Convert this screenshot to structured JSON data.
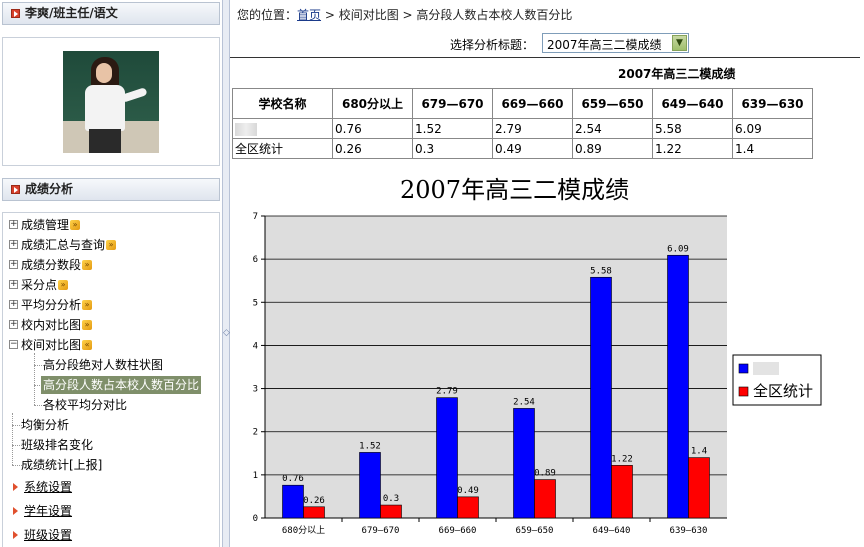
{
  "user_header": {
    "title": "李爽/班主任/语文"
  },
  "section_header": {
    "title": "成绩分析"
  },
  "tree": {
    "items": [
      {
        "label": "成绩管理",
        "expanded": false
      },
      {
        "label": "成绩汇总与查询",
        "expanded": false
      },
      {
        "label": "成绩分数段",
        "expanded": false
      },
      {
        "label": "采分点",
        "expanded": false
      },
      {
        "label": "平均分分析",
        "expanded": false
      },
      {
        "label": "校内对比图",
        "expanded": false
      },
      {
        "label": "校间对比图",
        "expanded": true
      }
    ],
    "sub_items": [
      {
        "label": "高分段绝对人数柱状图",
        "selected": false
      },
      {
        "label": "高分段人数占本校人数百分比",
        "selected": true
      },
      {
        "label": "各校平均分对比",
        "selected": false
      }
    ],
    "leaf_items": [
      {
        "label": "均衡分析"
      },
      {
        "label": "班级排名变化"
      },
      {
        "label": "成绩统计[上报]"
      }
    ]
  },
  "menu_links": [
    {
      "label": "系统设置"
    },
    {
      "label": "学年设置"
    },
    {
      "label": "班级设置"
    }
  ],
  "breadcrumb": {
    "prefix": "您的位置：",
    "home": "首页",
    "sep1": " > ",
    "level1": "校间对比图",
    "sep2": " > ",
    "level2": "高分段人数占本校人数百分比"
  },
  "selector": {
    "label": "选择分析标题：",
    "value": "2007年高三二模成绩"
  },
  "table": {
    "title": "2007年高三二模成绩",
    "headers": [
      "学校名称",
      "680分以上",
      "679—670",
      "669—660",
      "659—650",
      "649—640",
      "639—630"
    ],
    "rows": [
      {
        "name": "",
        "values": [
          "0.76",
          "1.52",
          "2.79",
          "2.54",
          "5.58",
          "6.09"
        ]
      },
      {
        "name": "全区统计",
        "values": [
          "0.26",
          "0.3",
          "0.49",
          "0.89",
          "1.22",
          "1.4"
        ]
      }
    ]
  },
  "chart_data": {
    "type": "bar",
    "title": "2007年高三二模成绩",
    "categories": [
      "680分以上",
      "679—670",
      "669—660",
      "659—650",
      "649—640",
      "639—630"
    ],
    "series": [
      {
        "name": "",
        "values": [
          0.76,
          1.52,
          2.79,
          2.54,
          5.58,
          6.09
        ],
        "color": "#0000ff"
      },
      {
        "name": "全区统计",
        "values": [
          0.26,
          0.3,
          0.49,
          0.89,
          1.22,
          1.4
        ],
        "color": "#ff0000"
      }
    ],
    "data_labels": [
      [
        "0.76",
        "1.52",
        "2.79",
        "2.54",
        "5.58",
        "6.09"
      ],
      [
        "0.26",
        "0.3",
        "0.49",
        "0.89",
        "1.22",
        "1.4"
      ]
    ],
    "ylim": [
      0,
      7
    ],
    "yticks": [
      "0",
      "1",
      "2",
      "3",
      "4",
      "5",
      "6",
      "7"
    ],
    "grid": true,
    "legend": "right",
    "plot_background": "#dddddd"
  }
}
